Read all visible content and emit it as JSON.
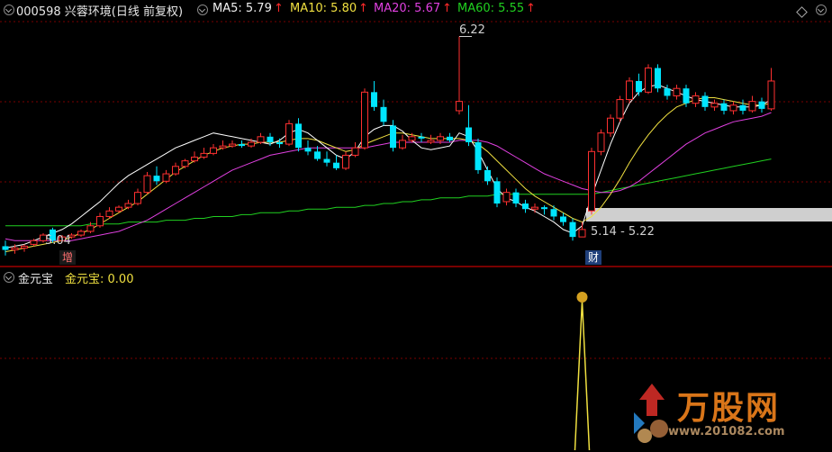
{
  "header": {
    "stock_label": "000598 兴蓉环境(日线 前复权)",
    "ma5": "MA5: 5.79",
    "ma10": "MA10: 5.80",
    "ma20": "MA20: 5.67",
    "ma60": "MA60: 5.55",
    "up_arrow": "↑"
  },
  "annotations": {
    "high": "6.22",
    "low": "5.04",
    "range": "5.14 - 5.22",
    "signal_increase": "增",
    "signal_finance": "财"
  },
  "indicator": {
    "name": "金元宝",
    "series_label": "金元宝",
    "value": ": 0.00"
  },
  "watermark": {
    "title": "万股网",
    "url": "www.201082.com"
  },
  "colors": {
    "up": "#ff3030",
    "down": "#00e5ff",
    "ma5": "#ffffff",
    "ma10": "#f0e040",
    "ma20": "#e040e0",
    "ma60": "#20d020",
    "grid": "#7a0000",
    "band": "#cfcfcf"
  },
  "chart_data": {
    "type": "candlestick",
    "candles": [
      [
        5.09,
        5.07,
        5.12,
        5.04
      ],
      [
        5.07,
        5.08,
        5.1,
        5.05
      ],
      [
        5.08,
        5.09,
        5.1,
        5.06
      ],
      [
        5.1,
        5.12,
        5.13,
        5.09
      ],
      [
        5.12,
        5.15,
        5.16,
        5.11
      ],
      [
        5.18,
        5.12,
        5.19,
        5.11
      ],
      [
        5.12,
        5.14,
        5.15,
        5.11
      ],
      [
        5.14,
        5.15,
        5.16,
        5.13
      ],
      [
        5.15,
        5.17,
        5.18,
        5.14
      ],
      [
        5.17,
        5.2,
        5.22,
        5.16
      ],
      [
        5.2,
        5.25,
        5.27,
        5.19
      ],
      [
        5.25,
        5.28,
        5.3,
        5.24
      ],
      [
        5.28,
        5.3,
        5.31,
        5.27
      ],
      [
        5.3,
        5.32,
        5.34,
        5.29
      ],
      [
        5.32,
        5.38,
        5.4,
        5.31
      ],
      [
        5.38,
        5.47,
        5.49,
        5.37
      ],
      [
        5.47,
        5.44,
        5.52,
        5.42
      ],
      [
        5.44,
        5.48,
        5.5,
        5.43
      ],
      [
        5.48,
        5.52,
        5.54,
        5.47
      ],
      [
        5.52,
        5.55,
        5.56,
        5.51
      ],
      [
        5.55,
        5.57,
        5.6,
        5.54
      ],
      [
        5.57,
        5.59,
        5.62,
        5.56
      ],
      [
        5.59,
        5.62,
        5.64,
        5.58
      ],
      [
        5.62,
        5.63,
        5.66,
        5.61
      ],
      [
        5.63,
        5.64,
        5.66,
        5.62
      ],
      [
        5.64,
        5.63,
        5.66,
        5.62
      ],
      [
        5.63,
        5.65,
        5.67,
        5.62
      ],
      [
        5.65,
        5.68,
        5.7,
        5.64
      ],
      [
        5.68,
        5.65,
        5.7,
        5.63
      ],
      [
        5.65,
        5.64,
        5.67,
        5.62
      ],
      [
        5.64,
        5.75,
        5.77,
        5.63
      ],
      [
        5.75,
        5.62,
        5.78,
        5.6
      ],
      [
        5.62,
        5.6,
        5.66,
        5.58
      ],
      [
        5.6,
        5.56,
        5.63,
        5.55
      ],
      [
        5.56,
        5.54,
        5.6,
        5.52
      ],
      [
        5.54,
        5.51,
        5.58,
        5.5
      ],
      [
        5.51,
        5.58,
        5.6,
        5.5
      ],
      [
        5.58,
        5.62,
        5.65,
        5.57
      ],
      [
        5.62,
        5.92,
        5.94,
        5.61
      ],
      [
        5.92,
        5.84,
        5.98,
        5.82
      ],
      [
        5.84,
        5.76,
        5.88,
        5.74
      ],
      [
        5.74,
        5.62,
        5.77,
        5.6
      ],
      [
        5.62,
        5.66,
        5.69,
        5.61
      ],
      [
        5.66,
        5.68,
        5.7,
        5.65
      ],
      [
        5.68,
        5.67,
        5.7,
        5.65
      ],
      [
        5.65,
        5.66,
        5.69,
        5.64
      ],
      [
        5.66,
        5.68,
        5.7,
        5.64
      ],
      [
        5.68,
        5.66,
        5.7,
        5.65
      ],
      [
        5.82,
        5.87,
        6.22,
        5.8
      ],
      [
        5.73,
        5.65,
        5.85,
        5.63
      ],
      [
        5.65,
        5.5,
        5.67,
        5.48
      ],
      [
        5.5,
        5.44,
        5.52,
        5.42
      ],
      [
        5.44,
        5.32,
        5.46,
        5.3
      ],
      [
        5.33,
        5.38,
        5.4,
        5.31
      ],
      [
        5.38,
        5.32,
        5.4,
        5.3
      ],
      [
        5.32,
        5.29,
        5.34,
        5.27
      ],
      [
        5.29,
        5.3,
        5.32,
        5.27
      ],
      [
        5.3,
        5.29,
        5.31,
        5.26
      ],
      [
        5.29,
        5.25,
        5.31,
        5.23
      ],
      [
        5.25,
        5.22,
        5.27,
        5.2
      ],
      [
        5.22,
        5.14,
        5.24,
        5.12
      ],
      [
        5.14,
        5.18,
        5.22,
        5.14
      ],
      [
        5.28,
        5.6,
        5.62,
        5.26
      ],
      [
        5.6,
        5.7,
        5.72,
        5.58
      ],
      [
        5.7,
        5.78,
        5.8,
        5.68
      ],
      [
        5.78,
        5.88,
        5.9,
        5.76
      ],
      [
        5.88,
        5.98,
        6.0,
        5.86
      ],
      [
        5.98,
        5.92,
        6.02,
        5.9
      ],
      [
        5.92,
        6.05,
        6.07,
        5.91
      ],
      [
        6.05,
        5.94,
        6.07,
        5.92
      ],
      [
        5.94,
        5.9,
        5.96,
        5.88
      ],
      [
        5.9,
        5.94,
        5.96,
        5.88
      ],
      [
        5.94,
        5.86,
        5.96,
        5.84
      ],
      [
        5.86,
        5.9,
        5.92,
        5.84
      ],
      [
        5.9,
        5.84,
        5.92,
        5.82
      ],
      [
        5.84,
        5.86,
        5.88,
        5.82
      ],
      [
        5.86,
        5.82,
        5.88,
        5.8
      ],
      [
        5.82,
        5.85,
        5.87,
        5.8
      ],
      [
        5.85,
        5.82,
        5.88,
        5.8
      ],
      [
        5.82,
        5.87,
        5.9,
        5.81
      ],
      [
        5.87,
        5.83,
        5.89,
        5.81
      ],
      [
        5.83,
        5.98,
        6.05,
        5.82
      ]
    ],
    "ma5": [
      5.08,
      5.09,
      5.1,
      5.12,
      5.14,
      5.16,
      5.18,
      5.21,
      5.25,
      5.29,
      5.33,
      5.38,
      5.43,
      5.47,
      5.5,
      5.53,
      5.56,
      5.59,
      5.62,
      5.64,
      5.66,
      5.68,
      5.7,
      5.69,
      5.68,
      5.67,
      5.66,
      5.65,
      5.64,
      5.66,
      5.7,
      5.72,
      5.7,
      5.66,
      5.62,
      5.58,
      5.56,
      5.6,
      5.68,
      5.72,
      5.74,
      5.74,
      5.71,
      5.66,
      5.62,
      5.61,
      5.62,
      5.63,
      5.7,
      5.68,
      5.6,
      5.5,
      5.4,
      5.35,
      5.33,
      5.3,
      5.28,
      5.25,
      5.22,
      5.18,
      5.16,
      5.2,
      5.36,
      5.5,
      5.64,
      5.76,
      5.86,
      5.92,
      5.95,
      5.96,
      5.94,
      5.92,
      5.9,
      5.88,
      5.87,
      5.86,
      5.85,
      5.84,
      5.84,
      5.84,
      5.85,
      5.88
    ],
    "ma10": [
      5.06,
      5.07,
      5.08,
      5.09,
      5.1,
      5.11,
      5.12,
      5.14,
      5.16,
      5.18,
      5.21,
      5.24,
      5.27,
      5.3,
      5.33,
      5.37,
      5.41,
      5.45,
      5.49,
      5.52,
      5.55,
      5.58,
      5.6,
      5.62,
      5.63,
      5.64,
      5.64,
      5.65,
      5.65,
      5.65,
      5.66,
      5.67,
      5.67,
      5.66,
      5.64,
      5.62,
      5.6,
      5.61,
      5.64,
      5.66,
      5.68,
      5.7,
      5.7,
      5.69,
      5.68,
      5.67,
      5.67,
      5.67,
      5.67,
      5.66,
      5.64,
      5.6,
      5.55,
      5.5,
      5.45,
      5.4,
      5.36,
      5.33,
      5.3,
      5.27,
      5.24,
      5.22,
      5.25,
      5.3,
      5.37,
      5.45,
      5.54,
      5.62,
      5.69,
      5.75,
      5.8,
      5.84,
      5.86,
      5.88,
      5.89,
      5.89,
      5.88,
      5.87,
      5.86,
      5.85,
      5.85,
      5.86
    ],
    "ma20": [
      5.13,
      5.12,
      5.12,
      5.12,
      5.12,
      5.12,
      5.12,
      5.12,
      5.13,
      5.14,
      5.15,
      5.16,
      5.17,
      5.19,
      5.21,
      5.23,
      5.26,
      5.29,
      5.32,
      5.35,
      5.38,
      5.41,
      5.44,
      5.47,
      5.5,
      5.52,
      5.54,
      5.56,
      5.58,
      5.59,
      5.6,
      5.61,
      5.62,
      5.62,
      5.62,
      5.62,
      5.62,
      5.62,
      5.62,
      5.63,
      5.64,
      5.65,
      5.65,
      5.65,
      5.65,
      5.65,
      5.65,
      5.65,
      5.66,
      5.66,
      5.66,
      5.65,
      5.63,
      5.6,
      5.57,
      5.54,
      5.51,
      5.48,
      5.46,
      5.44,
      5.42,
      5.4,
      5.39,
      5.38,
      5.38,
      5.39,
      5.41,
      5.44,
      5.48,
      5.52,
      5.56,
      5.6,
      5.64,
      5.67,
      5.7,
      5.72,
      5.74,
      5.76,
      5.77,
      5.78,
      5.79,
      5.81
    ],
    "ma60": [
      5.2,
      5.2,
      5.2,
      5.2,
      5.2,
      5.2,
      5.2,
      5.2,
      5.2,
      5.21,
      5.21,
      5.21,
      5.21,
      5.22,
      5.22,
      5.22,
      5.22,
      5.23,
      5.23,
      5.23,
      5.24,
      5.24,
      5.25,
      5.25,
      5.25,
      5.26,
      5.26,
      5.27,
      5.27,
      5.27,
      5.28,
      5.28,
      5.29,
      5.29,
      5.29,
      5.3,
      5.3,
      5.3,
      5.31,
      5.31,
      5.32,
      5.32,
      5.33,
      5.33,
      5.34,
      5.34,
      5.35,
      5.35,
      5.35,
      5.36,
      5.36,
      5.36,
      5.37,
      5.37,
      5.37,
      5.37,
      5.37,
      5.37,
      5.37,
      5.37,
      5.37,
      5.37,
      5.37,
      5.38,
      5.39,
      5.4,
      5.41,
      5.42,
      5.43,
      5.44,
      5.45,
      5.46,
      5.47,
      5.48,
      5.49,
      5.5,
      5.51,
      5.52,
      5.53,
      5.54,
      5.55,
      5.56
    ],
    "y_range": [
      5.0,
      6.3
    ],
    "indicator_values": {
      "peak_index": 61,
      "peak_value": 1,
      "baseline": 0
    }
  }
}
